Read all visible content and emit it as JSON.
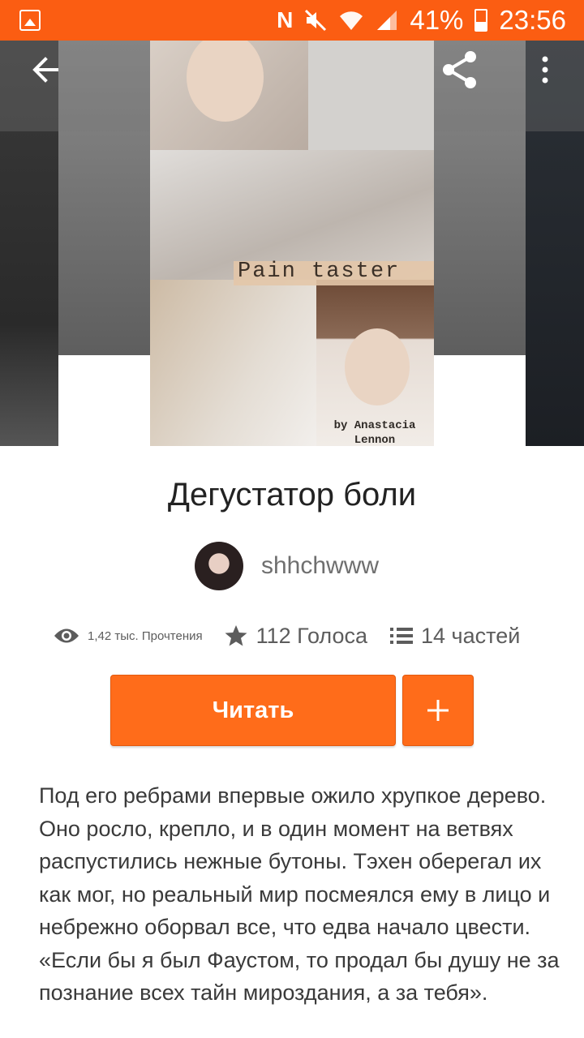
{
  "status_bar": {
    "battery": "41%",
    "time": "23:56",
    "notification_letter": "N",
    "icons": [
      "gallery-icon",
      "n-icon",
      "mute-icon",
      "wifi-icon",
      "signal-icon",
      "battery-icon"
    ]
  },
  "toolbar": {
    "back_icon": "arrow-left-icon",
    "share_icon": "share-icon",
    "more_icon": "more-vertical-icon"
  },
  "cover": {
    "title_text": "Pain taster",
    "byline_1": "by Anastacia",
    "byline_2": "Lennon"
  },
  "story": {
    "title": "Дегустатор боли",
    "author": "shhchwww",
    "stats": {
      "reads": "1,42 тыс. Прочтения",
      "votes": "112 Голоса",
      "parts": "14 частей"
    },
    "read_button": "Читать",
    "add_button_icon": "plus-icon",
    "description_1": "Под его ребрами впервые ожило хрупкое дерево. Оно росло, крепло, и в один момент на ветвях распустились нежные бутоны. Тэхен оберегал их как мог, но реальный мир посмеялся ему в лицо и небрежно оборвал все, что едва начало цвести.",
    "description_2": "«Если бы я был Фаустом, то продал бы душу не за познание всех тайн мироздания, а за тебя»."
  },
  "colors": {
    "accent": "#ff6c1a",
    "status_bar": "#fb5d12"
  }
}
